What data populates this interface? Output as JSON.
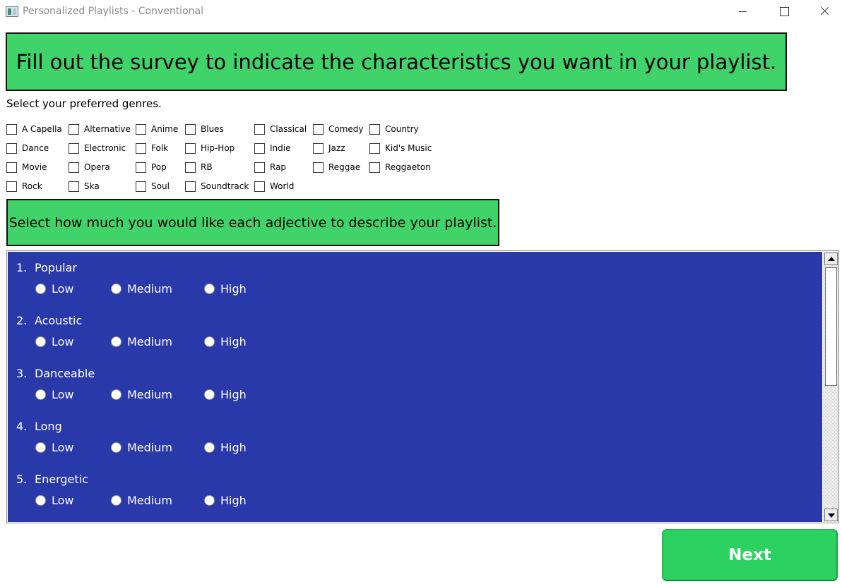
{
  "window": {
    "title": "Personalized Playlists - Conventional",
    "app_icon": "app-window-icon",
    "controls": [
      "minimize-icon",
      "maximize-icon",
      "close-icon"
    ]
  },
  "header": {
    "banner_text": "Fill out the survey to indicate the characteristics you want in your playlist."
  },
  "genres": {
    "prompt": "Select your preferred genres.",
    "rows": [
      [
        "A Capella",
        "Alternative",
        "Anime",
        "Blues",
        "Classical",
        "Comedy",
        "Country"
      ],
      [
        "Dance",
        "Electronic",
        "Folk",
        "Hip-Hop",
        "Indie",
        "Jazz",
        "Kid's Music"
      ],
      [
        "Movie",
        "Opera",
        "Pop",
        "RB",
        "Rap",
        "Reggae",
        "Reggaeton"
      ],
      [
        "Rock",
        "Ska",
        "Soul",
        "Soundtrack",
        "World"
      ]
    ],
    "checked": []
  },
  "adjectives": {
    "banner_text": "Select how much you would like each adjective to describe your playlist.",
    "questions": [
      {
        "number": "1.",
        "label": "Popular",
        "options": [
          "Low",
          "Medium",
          "High"
        ],
        "selected": null
      },
      {
        "number": "2.",
        "label": "Acoustic",
        "options": [
          "Low",
          "Medium",
          "High"
        ],
        "selected": null
      },
      {
        "number": "3.",
        "label": "Danceable",
        "options": [
          "Low",
          "Medium",
          "High"
        ],
        "selected": null
      },
      {
        "number": "4.",
        "label": "Long",
        "options": [
          "Low",
          "Medium",
          "High"
        ],
        "selected": null
      },
      {
        "number": "5.",
        "label": "Energetic",
        "options": [
          "Low",
          "Medium",
          "High"
        ],
        "selected": null
      }
    ]
  },
  "footer": {
    "next_label": "Next"
  },
  "colors": {
    "banner_green": "#3fd36a",
    "panel_blue": "#2939aa",
    "next_green": "#2bd262"
  }
}
